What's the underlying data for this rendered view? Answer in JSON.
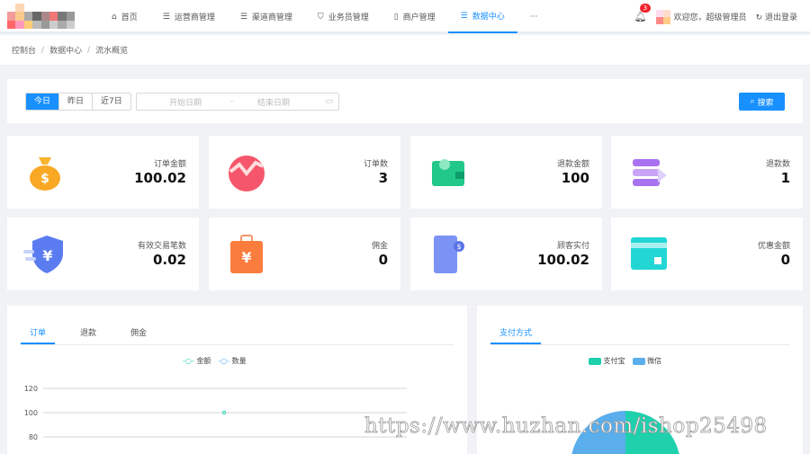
{
  "header": {
    "nav": [
      {
        "label": "首页",
        "icon": "home-icon"
      },
      {
        "label": "运营商管理",
        "icon": "list-icon"
      },
      {
        "label": "渠道商管理",
        "icon": "list-icon"
      },
      {
        "label": "业务员管理",
        "icon": "shield-icon"
      },
      {
        "label": "商户管理",
        "icon": "file-icon"
      },
      {
        "label": "数据中心",
        "icon": "list-icon",
        "active": true
      },
      {
        "label": "···"
      }
    ],
    "notifications": "3",
    "welcome": "欢迎您，超级管理员",
    "logout": "退出登录"
  },
  "breadcrumb": [
    "控制台",
    "数据中心",
    "流水概览"
  ],
  "filter": {
    "ranges": [
      "今日",
      "昨日",
      "近7日"
    ],
    "start_placeholder": "开始日期",
    "sep": "-",
    "end_placeholder": "结束日期",
    "search": "搜索"
  },
  "stats": [
    {
      "label": "订单金额",
      "value": "100.02"
    },
    {
      "label": "订单数",
      "value": "3"
    },
    {
      "label": "退款金额",
      "value": "100"
    },
    {
      "label": "退款数",
      "value": "1"
    },
    {
      "label": "有效交易笔数",
      "value": "0.02"
    },
    {
      "label": "佣金",
      "value": "0"
    },
    {
      "label": "顾客实付",
      "value": "100.02"
    },
    {
      "label": "优惠金额",
      "value": "0"
    }
  ],
  "order_panel": {
    "tabs": [
      "订单",
      "退款",
      "佣金"
    ],
    "legend": [
      "金额",
      "数量"
    ]
  },
  "pay_panel": {
    "tabs": [
      "支付方式"
    ],
    "legend": [
      "支付宝",
      "微信"
    ]
  },
  "colors": {
    "primary": "#1890ff",
    "alipay": "#1fd0ad",
    "wechat": "#5aaeec"
  },
  "chart_data": [
    {
      "type": "line",
      "series": [
        {
          "name": "金额",
          "values": [
            100
          ]
        }
      ],
      "yticks": [
        80,
        100,
        120
      ],
      "grid": true,
      "legend": "top-center"
    },
    {
      "type": "pie",
      "categories": [
        "支付宝",
        "微信"
      ],
      "values": [
        50,
        50
      ],
      "legend": "top-center"
    }
  ],
  "watermark": "https://www.huzhan.com/ishop25498"
}
